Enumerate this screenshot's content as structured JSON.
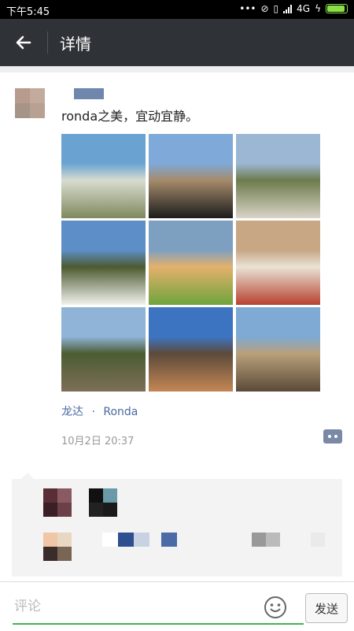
{
  "status_bar": {
    "time": "下午5:45",
    "network": "4G",
    "icons": [
      "dots-icon",
      "mute-icon",
      "vibrate-icon",
      "signal-icon",
      "battery-icon"
    ]
  },
  "nav": {
    "title": "详情",
    "back_icon": "arrow-left-icon"
  },
  "post": {
    "text": "ronda之美，宜动宜静。",
    "location": {
      "city": "龙达",
      "separator": "·",
      "place": "Ronda"
    },
    "timestamp": "10月2日 20:37",
    "photos": [
      {
        "alt": "Bienvenidos Serranía Ronda sign",
        "colors": [
          "#6aa3d1",
          "#7e8a5d",
          "#d8dcd0"
        ]
      },
      {
        "alt": "car side mirror view",
        "colors": [
          "#7fa9d8",
          "#1c1c1c",
          "#a58b6b"
        ]
      },
      {
        "alt": "white cliff houses",
        "colors": [
          "#9cb7d3",
          "#d9d4c7",
          "#6d7b4c"
        ]
      },
      {
        "alt": "white building with statue",
        "colors": [
          "#5d8ec7",
          "#f2f2ee",
          "#4d5a30"
        ]
      },
      {
        "alt": "woman sitting on grass",
        "colors": [
          "#7ea0c0",
          "#6ea43c",
          "#e4b06c"
        ]
      },
      {
        "alt": "woman by colonnade",
        "colors": [
          "#c7a784",
          "#b7412f",
          "#e9e3d5"
        ]
      },
      {
        "alt": "gorge cliffs",
        "colors": [
          "#8fb4d7",
          "#7d6f57",
          "#4b5c32"
        ]
      },
      {
        "alt": "old street with buildings",
        "colors": [
          "#3d74c2",
          "#c48755",
          "#5c4a3a"
        ]
      },
      {
        "alt": "bridge over gorge",
        "colors": [
          "#7eaad3",
          "#5b4a38",
          "#b9a07b"
        ]
      }
    ]
  },
  "bottom": {
    "comment_placeholder": "评论",
    "send_label": "发送",
    "emoji_icon": "smiley-icon"
  },
  "colors": {
    "navbar": "#2f3337",
    "accent_green": "#3fb34f",
    "link_blue": "#4a6aa0"
  }
}
